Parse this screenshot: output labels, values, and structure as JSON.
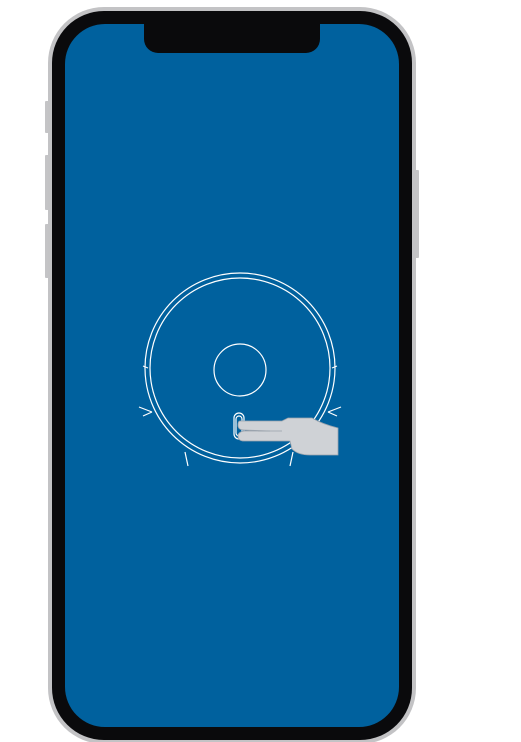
{
  "device": {
    "type": "smartphone",
    "screen_color": "#00619e",
    "frame_color": "#c3c3c5",
    "bezel_color": "#0a0a0c"
  },
  "illustration": {
    "subject": "robot-vacuum-top-view",
    "gesture": "hand-pressing-button",
    "line_color": "#ffffff",
    "hand_color": "#cfd2d6"
  }
}
